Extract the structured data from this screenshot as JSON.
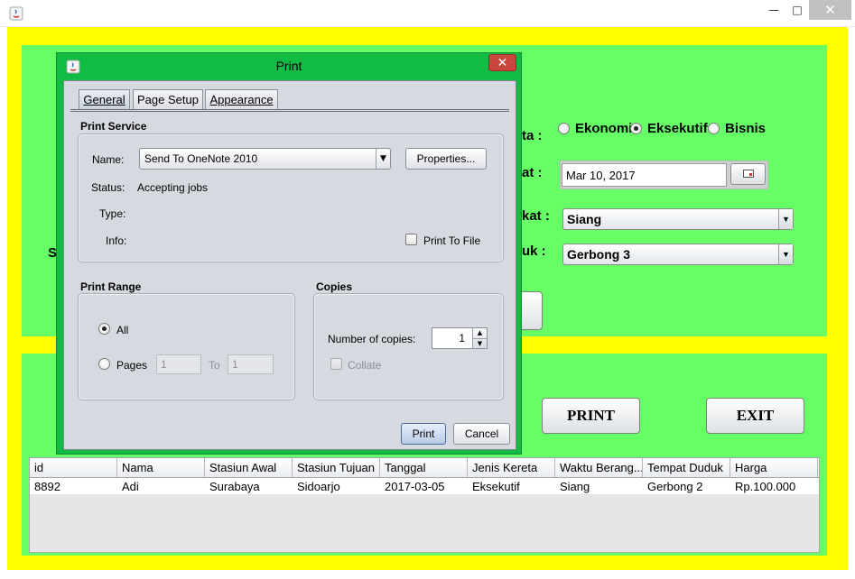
{
  "window": {
    "minimize_glyph": "—",
    "maximize_glyph": "□",
    "close_glyph": "✕"
  },
  "form": {
    "kelas_label_fragment": "ta :",
    "tanggal_label_fragment": "at :",
    "waktu_label_fragment": "kat :",
    "tempat_label_fragment": "uk :",
    "hidden_label_fragment": "S",
    "class_options": [
      "Ekonomi",
      "Eksekutif",
      "Bisnis"
    ],
    "selected_class": "Eksekutif",
    "date_value": "Mar 10, 2017",
    "time_value": "Siang",
    "seat_value": "Gerbong 3"
  },
  "buttons": {
    "print_label": "PRINT",
    "exit_label": "EXIT"
  },
  "table": {
    "columns": [
      "id",
      "Nama",
      "Stasiun Awal",
      "Stasiun Tujuan",
      "Tanggal",
      "Jenis Kereta",
      "Waktu Berang...",
      "Tempat Duduk",
      "Harga"
    ],
    "rows": [
      [
        "8892",
        "Adi",
        "Surabaya",
        "Sidoarjo",
        "2017-03-05",
        "Eksekutif",
        "Siang",
        "Gerbong 2",
        "Rp.100.000"
      ]
    ]
  },
  "print_dialog": {
    "title": "Print",
    "close_glyph": "✕",
    "tabs": [
      "General",
      "Page Setup",
      "Appearance"
    ],
    "print_service": {
      "title": "Print Service",
      "name_label": "Name:",
      "name_value": "Send To OneNote 2010",
      "properties_label": "Properties...",
      "status_label": "Status:",
      "status_value": "Accepting jobs",
      "type_label": "Type:",
      "info_label": "Info:",
      "print_to_file_label": "Print To File"
    },
    "print_range": {
      "title": "Print Range",
      "all_label": "All",
      "pages_label": "Pages",
      "from_value": "1",
      "to_label": "To",
      "to_value": "1"
    },
    "copies": {
      "title": "Copies",
      "number_label": "Number of copies:",
      "number_value": "1",
      "collate_label": "Collate"
    },
    "print_button": "Print",
    "cancel_button": "Cancel"
  }
}
